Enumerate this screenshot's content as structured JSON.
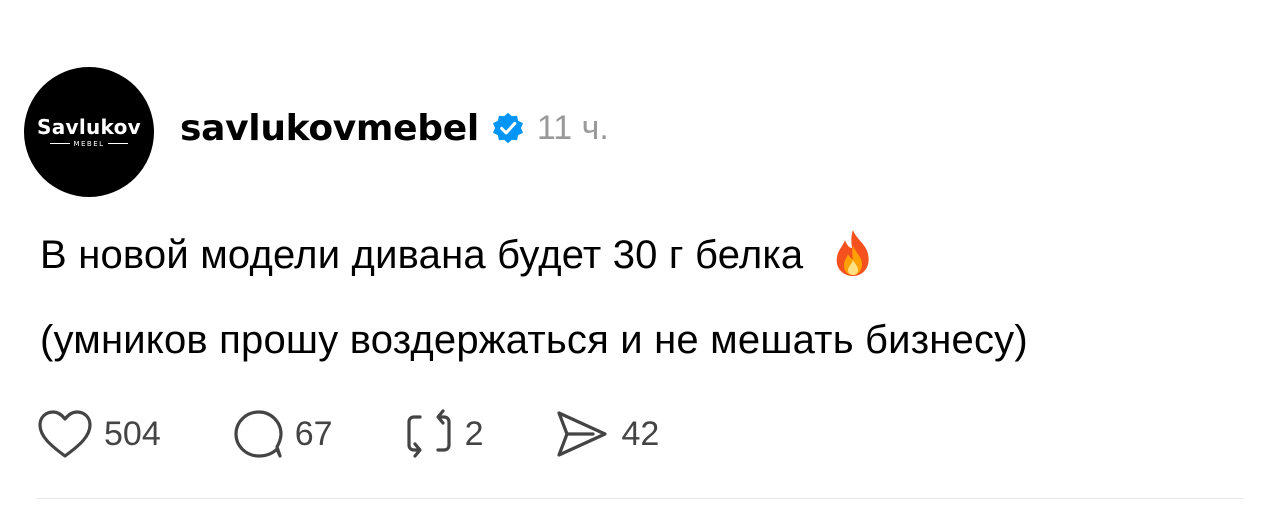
{
  "avatar": {
    "brand": "Savlukov",
    "sub": "MEBEL"
  },
  "header": {
    "username": "savlukovmebel",
    "time": "11 ч."
  },
  "post": {
    "line1": "В новой модели дивана будет 30 г белка",
    "line2": "(умников прошу воздержаться и не мешать бизнесу)"
  },
  "actions": {
    "likes": "504",
    "comments": "67",
    "reposts": "2",
    "shares": "42"
  },
  "colors": {
    "verified": "#0095F6",
    "muted": "#999999",
    "icon": "#444444"
  }
}
